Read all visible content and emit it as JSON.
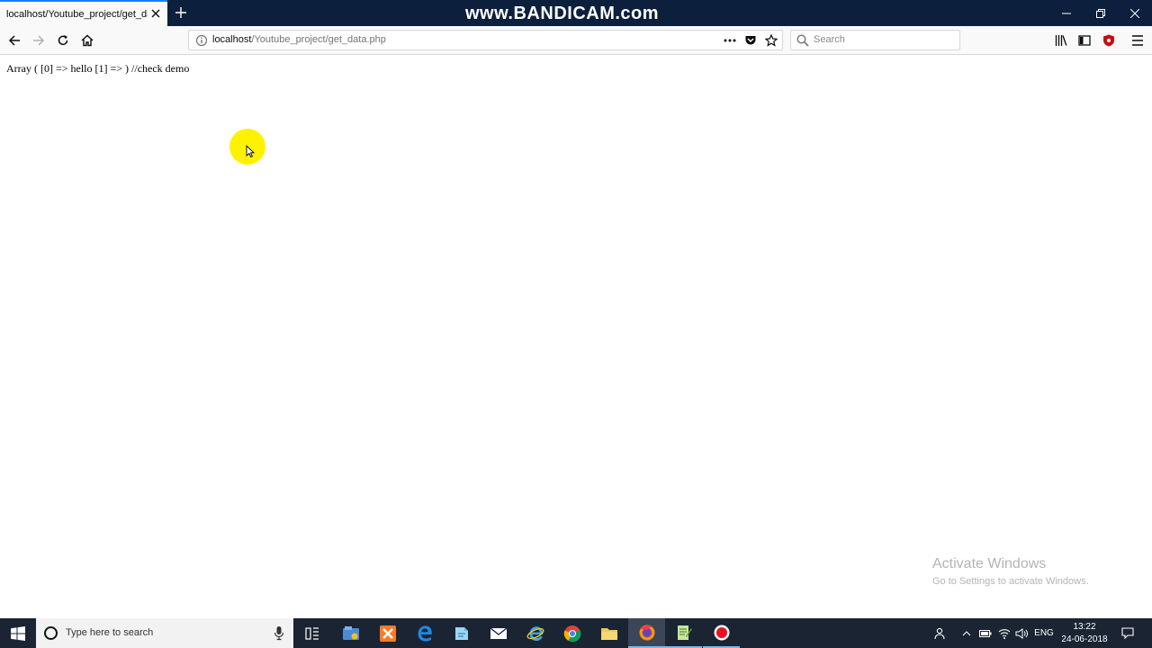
{
  "browser": {
    "tab_title": "localhost/Youtube_project/get_data.php",
    "url_host": "localhost",
    "url_path": "/Youtube_project/get_data.php",
    "search_placeholder": "Search"
  },
  "watermark": "www.BANDICAM.com",
  "page": {
    "output_text": "Array ( [0] => hello [1] => ) //check demo"
  },
  "activation": {
    "title": "Activate Windows",
    "subtitle": "Go to Settings to activate Windows."
  },
  "taskbar": {
    "search_placeholder": "Type here to search",
    "language": "ENG",
    "time": "13:22",
    "date": "24-06-2018"
  },
  "colors": {
    "title_bar": "#0c1f3d",
    "accent": "#0a84ff",
    "taskbar": "#1a2433",
    "cursor_highlight": "#fff200"
  }
}
